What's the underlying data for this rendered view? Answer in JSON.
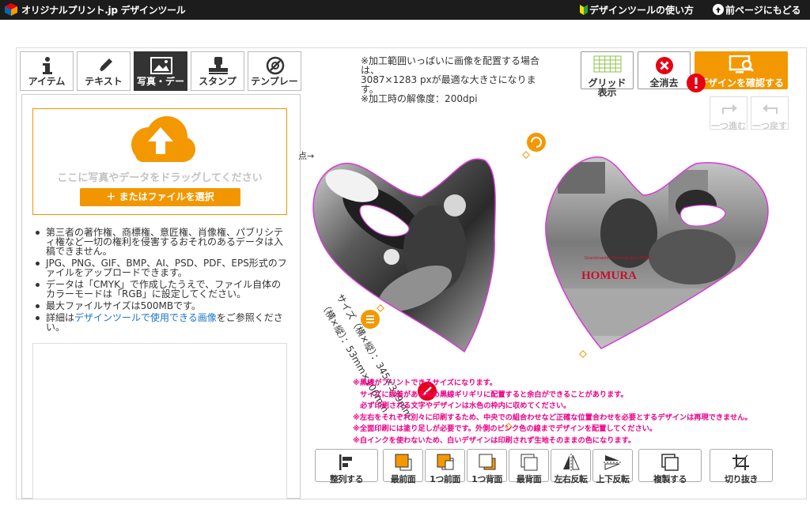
{
  "header": {
    "logo_text": "オリジナルプリント.jp デザインツール",
    "guide_link": "デザインツールの使い方",
    "back_link": "前ページにもどる"
  },
  "tabs": [
    {
      "label": "アイテム",
      "icon": "info-icon"
    },
    {
      "label": "テキスト",
      "icon": "pen-icon"
    },
    {
      "label": "写真・デー",
      "icon": "image-icon",
      "active": true
    },
    {
      "label": "スタンプ",
      "icon": "stamp-icon"
    },
    {
      "label": "テンプレー",
      "icon": "template-icon"
    }
  ],
  "upload": {
    "drop_text": "ここに写真やデータをドラッグしてください",
    "file_button": "＋ またはファイルを選択"
  },
  "rules": [
    "第三者の著作権、商標権、意匠権、肖像権、パブリシティ権など一切の権利を侵害するおそれのあるデータは入稿できません。",
    "JPG、PNG、GIF、BMP、AI、PSD、PDF、EPS形式のファイルをアップロードできます。",
    "データは「CMYK」で作成したうえで、ファイル自体のカラーモードは「RGB」に設定してください。",
    "最大ファイルサイズは500MBです。"
  ],
  "rule_link": {
    "prefix": "詳細は",
    "link": "デザインツールで使用できる画像",
    "suffix": "をご参照ください。"
  },
  "info": {
    "lines": [
      "※加工範囲いっぱいに画像を配置する場合は、",
      "3087×1283 pxが最適な大きさになります。",
      "※加工時の解像度：200dpi"
    ]
  },
  "toolbar": {
    "grid_label": "グリッド表示",
    "clear_label": "全消去",
    "preview_label": "デザインを確認する",
    "redo_label": "一つ進む",
    "undo_label": "一つ戻す"
  },
  "canvas": {
    "origin_label": "原点",
    "size_label": "サイズ（横×縦）：345×339mm",
    "size_label2": "（横×縦）：53mm×106mm",
    "logo_text": "HOMURA",
    "logo_sub": "Grandmaster Commander's Fight"
  },
  "notes": [
    "※黒線がプリントできるサイズになります。",
    "　サイズに誤差があるため黒線ギリギリに配置すると余白ができることがあります。",
    "　必ず印刷される文字やデザインは水色の枠内に収めてください。",
    "※左右をそれぞれ別々に印刷するため、中央での組合わせなど正確な位置合わせを必要とするデザインは再現できません。",
    "※全面印刷には塗り足しが必要です。外側のピンク色の線までデザインを配置してください。",
    "※白インクを使わないため、白いデザインは印刷されず生地そのままの色になります。"
  ],
  "bottom_buttons": [
    {
      "label": "整列する",
      "icon": "align-icon"
    },
    {
      "label": "最前面",
      "icon": "bring-front-icon"
    },
    {
      "label": "1つ前面",
      "icon": "bring-forward-icon"
    },
    {
      "label": "1つ背面",
      "icon": "send-backward-icon"
    },
    {
      "label": "最背面",
      "icon": "send-back-icon"
    },
    {
      "label": "左右反転",
      "icon": "flip-horizontal-icon"
    },
    {
      "label": "上下反転",
      "icon": "flip-vertical-icon"
    },
    {
      "label": "複製する",
      "icon": "duplicate-icon"
    },
    {
      "label": "切り抜き",
      "icon": "crop-icon"
    }
  ],
  "colors": {
    "accent": "#f39800",
    "header_bg": "#1c1c1c",
    "warning_red": "#e60012",
    "note_pink": "#ee0088",
    "link_blue": "#1a73c9"
  }
}
